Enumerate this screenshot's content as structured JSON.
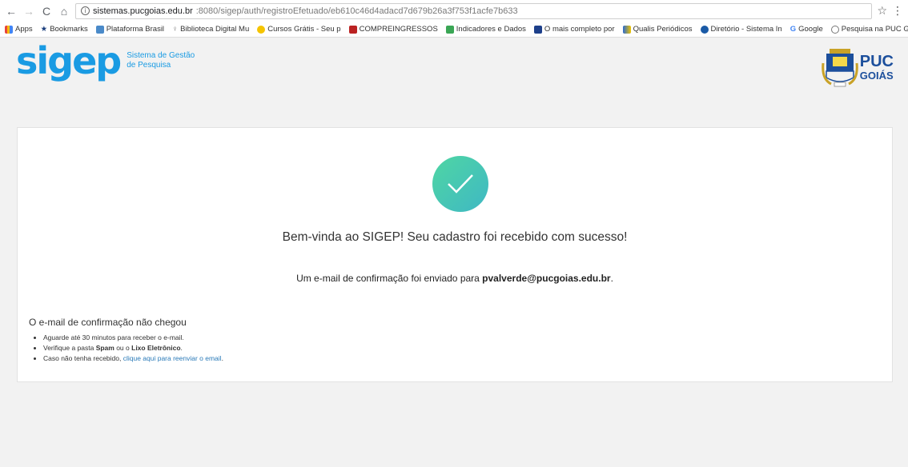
{
  "browser": {
    "url_host": "sistemas.pucgoias.edu.br",
    "url_path": ":8080/sigep/auth/registroEfetuado/eb610c46d4adacd7d679b26a3f753f1acfe7b633",
    "bookmarks": [
      "Apps",
      "Bookmarks",
      "Plataforma Brasil",
      "Biblioteca Digital Mu",
      "Cursos Grátis - Seu p",
      "COMPREINGRESSOS",
      "Indicadores e Dados",
      "O mais completo por",
      "Qualis Periódicos",
      "Diretório - Sistema In",
      "Google",
      "Pesquisa na PUC Goi"
    ],
    "more": "»"
  },
  "header": {
    "logo_word": "sigep",
    "logo_sub_1": "Sistema de Gestão",
    "logo_sub_2": "de Pesquisa",
    "puc_1": "PUC",
    "puc_2": "GOIÁS"
  },
  "main": {
    "headline": "Bem-vinda ao SIGEP! Seu cadastro foi recebido com sucesso!",
    "confirm_prefix": "Um e-mail de confirmação foi enviado para ",
    "confirm_email": "pvalverde@pucgoias.edu.br",
    "confirm_suffix": ".",
    "faq_title": "O e-mail de confirmação não chegou",
    "faq_1": "Aguarde até 30 minutos para receber o e-mail.",
    "faq_2_a": "Verifique a pasta ",
    "faq_2_b": "Spam",
    "faq_2_c": " ou o ",
    "faq_2_d": "Lixo Eletrônico",
    "faq_2_e": ".",
    "faq_3_a": "Caso não tenha recebido, ",
    "faq_3_link": "clique aqui para reenviar o email",
    "faq_3_b": "."
  },
  "colors": {
    "brand": "#1a9be3",
    "check_start": "#4fd6a3",
    "check_end": "#3fb8c4",
    "link": "#2a7ab8"
  }
}
